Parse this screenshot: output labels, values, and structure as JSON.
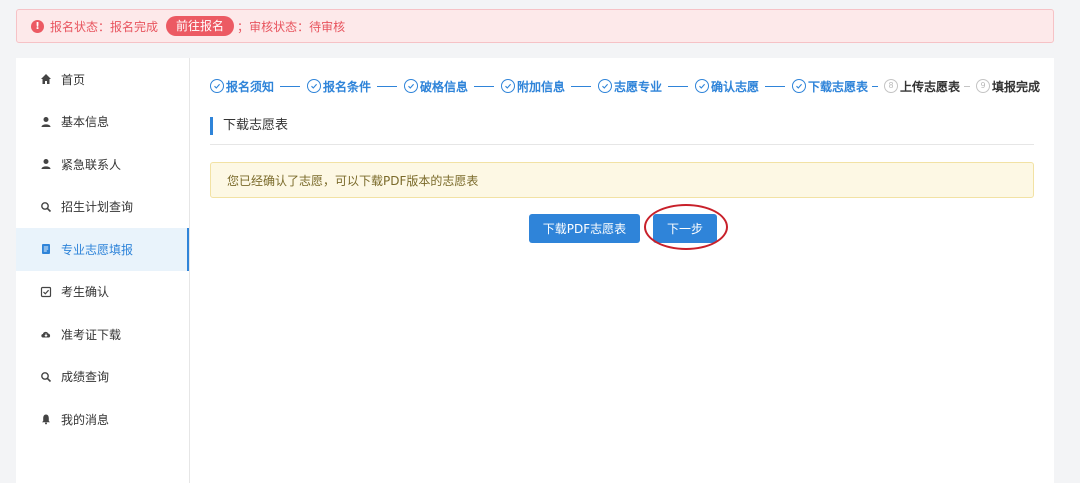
{
  "status_bar": {
    "reg_status_label": "报名状态：",
    "reg_status_value": "报名完成",
    "go_register_button": "前往报名",
    "separator": "；",
    "review_status_label": "审核状态：",
    "review_status_value": "待审核",
    "warn_glyph": "!",
    "color": "#ec5a63"
  },
  "sidebar": {
    "items": [
      {
        "label": "首页",
        "icon": "home-icon"
      },
      {
        "label": "基本信息",
        "icon": "user-icon"
      },
      {
        "label": "紧急联系人",
        "icon": "user-icon"
      },
      {
        "label": "招生计划查询",
        "icon": "search-icon"
      },
      {
        "label": "专业志愿填报",
        "icon": "document-icon",
        "active": true
      },
      {
        "label": "考生确认",
        "icon": "checkbox-icon"
      },
      {
        "label": "准考证下载",
        "icon": "cloud-download-icon"
      },
      {
        "label": "成绩查询",
        "icon": "search-icon"
      },
      {
        "label": "我的消息",
        "icon": "bell-icon"
      }
    ]
  },
  "steps": [
    {
      "label": "报名须知",
      "done": true
    },
    {
      "label": "报名条件",
      "done": true
    },
    {
      "label": "破格信息",
      "done": true
    },
    {
      "label": "附加信息",
      "done": true
    },
    {
      "label": "志愿专业",
      "done": true
    },
    {
      "label": "确认志愿",
      "done": true
    },
    {
      "label": "下载志愿表",
      "done": true
    },
    {
      "label": "上传志愿表",
      "done": false,
      "number": "8"
    },
    {
      "label": "填报完成",
      "done": false,
      "number": "9"
    }
  ],
  "section_title": "下载志愿表",
  "notice": "您已经确认了志愿，可以下载PDF版本的志愿表",
  "buttons": {
    "download_pdf": "下载PDF志愿表",
    "next": "下一步"
  },
  "colors": {
    "primary": "#2f84d9",
    "highlight_ring": "#c8202a",
    "notice_bg": "#fdf8e4"
  }
}
